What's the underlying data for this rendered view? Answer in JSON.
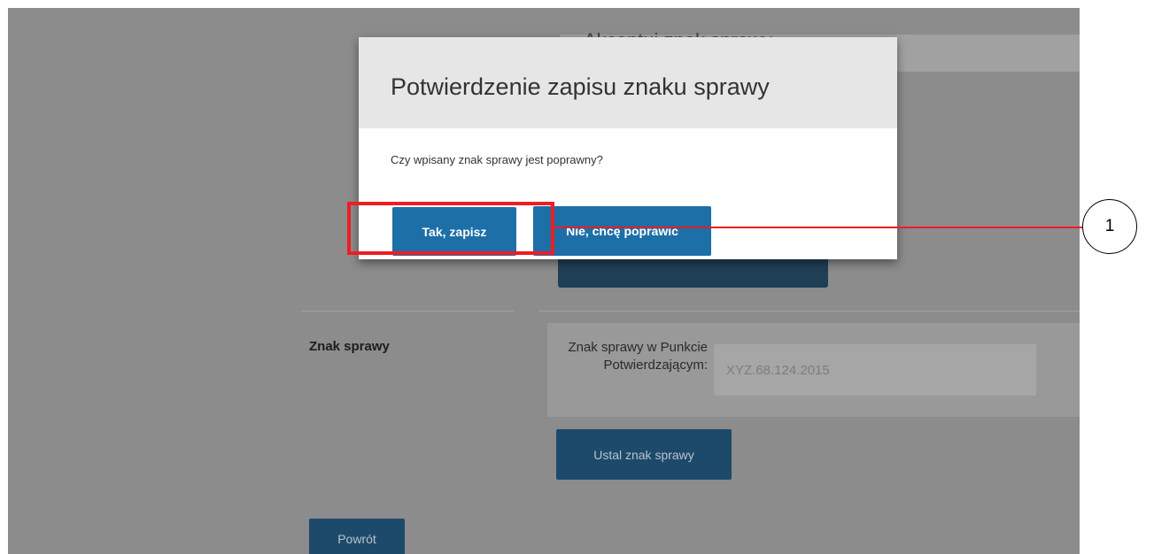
{
  "background": {
    "header_title": "Akceptuj znak sprawy",
    "case_section_label": "Znak sprawy",
    "field_label": "Znak sprawy w Punkcie Potwierdzającym:",
    "field_placeholder": "XYZ.68.124.2015",
    "set_case_button": "Ustal znak sprawy",
    "back_button": "Powrót"
  },
  "modal": {
    "title": "Potwierdzenie zapisu znaku sprawy",
    "message": "Czy wpisany znak sprawy jest poprawny?",
    "confirm_button": "Tak, zapisz",
    "reject_button": "Nie, chcę poprawić"
  },
  "annotation": {
    "callout_number": "1",
    "color": "#ee1d23"
  },
  "colors": {
    "modal_button": "#1d6fa8",
    "overlay": "#8c8c8c"
  }
}
